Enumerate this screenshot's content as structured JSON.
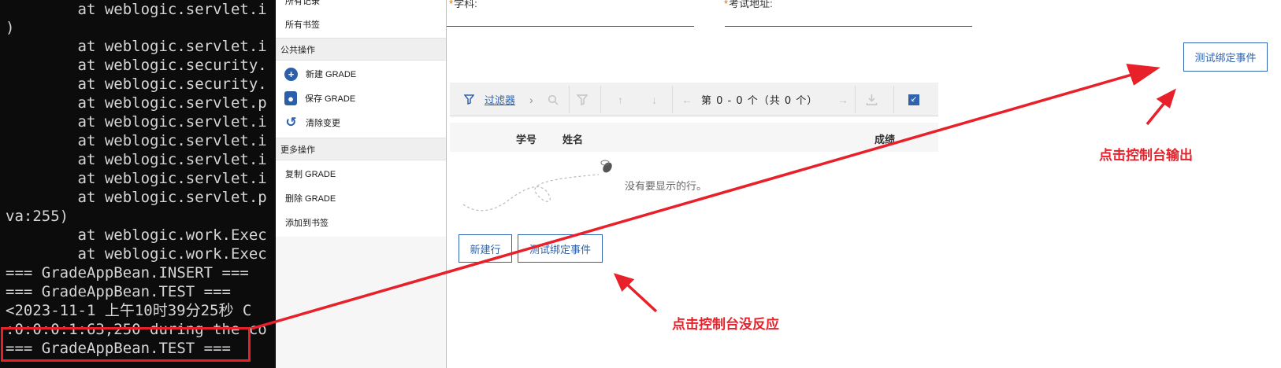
{
  "console": {
    "lines": [
      "        at weblogic.servlet.i",
      ")",
      "        at weblogic.servlet.i",
      "        at weblogic.security.",
      "        at weblogic.security.",
      "        at weblogic.servlet.p",
      "        at weblogic.servlet.i",
      "        at weblogic.servlet.i",
      "        at weblogic.servlet.i",
      "        at weblogic.servlet.i",
      "        at weblogic.servlet.p",
      "va:255)",
      "        at weblogic.work.Exec",
      "        at weblogic.work.Exec",
      "=== GradeAppBean.INSERT ===",
      "=== GradeAppBean.TEST ===",
      "<2023-11-1 上午10时39分25秒 C",
      ":0:0:0:1:63,250 during the co",
      "=== GradeAppBean.TEST ==="
    ]
  },
  "sidebar": {
    "all_records": "所有记录",
    "all_bookmarks": "所有书签",
    "public_ops": "公共操作",
    "new_grade": "新建 GRADE",
    "save_grade": "保存 GRADE",
    "clear_changes": "清除变更",
    "more_ops": "更多操作",
    "copy_grade": "复制 GRADE",
    "delete_grade": "删除 GRADE",
    "add_bookmark": "添加到书签"
  },
  "form": {
    "subject_label": "学科:",
    "exam_address_label": "考试地址:",
    "test_bind_button": "测试绑定事件"
  },
  "toolbar": {
    "filter_label": "过滤器",
    "pager_text": "第 0 - 0 个（共 0 个）"
  },
  "table": {
    "columns": [
      "学号",
      "姓名",
      "成绩"
    ],
    "empty_text": "没有要显示的行。"
  },
  "actions": {
    "new_row": "新建行",
    "test_bind": "测试绑定事件"
  },
  "annotations": {
    "console_output": "点击控制台输出",
    "console_no_response": "点击控制台没反应"
  },
  "colors": {
    "accent": "#2f63ad",
    "annotation_red": "#e8202a",
    "console_bg": "#0c0c0c"
  }
}
